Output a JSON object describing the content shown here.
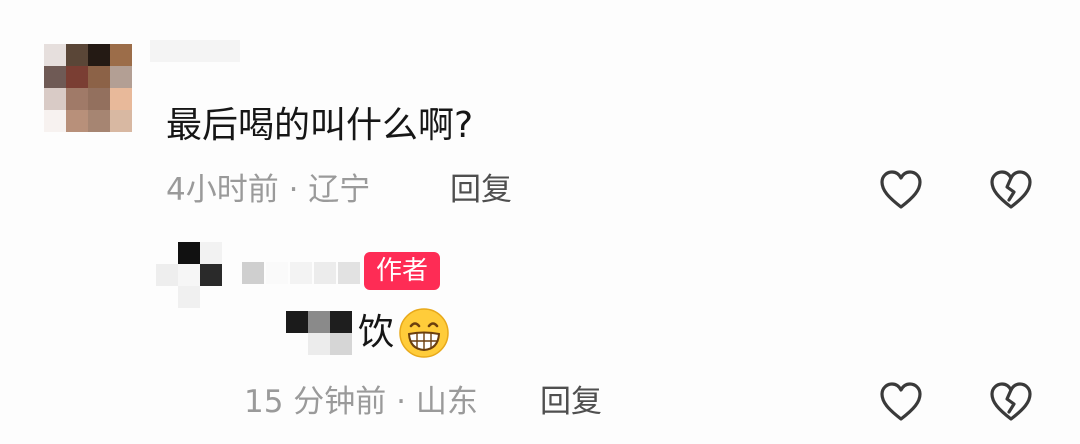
{
  "comment": {
    "text": "最后喝的叫什么啊?",
    "meta": "4小时前 · 辽宁",
    "reply_label": "回复"
  },
  "reply": {
    "badge": "作者",
    "text": "饮",
    "emoji": "grinning-face-emoji",
    "meta": "15 分钟前 · 山东",
    "reply_label": "回复"
  },
  "icons": {
    "like": "heart-outline-icon",
    "dislike": "broken-heart-icon",
    "icon_color": "#3a3a3a"
  },
  "colors": {
    "author_badge": "#fe2c55",
    "meta_text": "#9a9a9a",
    "body_text": "#161616"
  }
}
